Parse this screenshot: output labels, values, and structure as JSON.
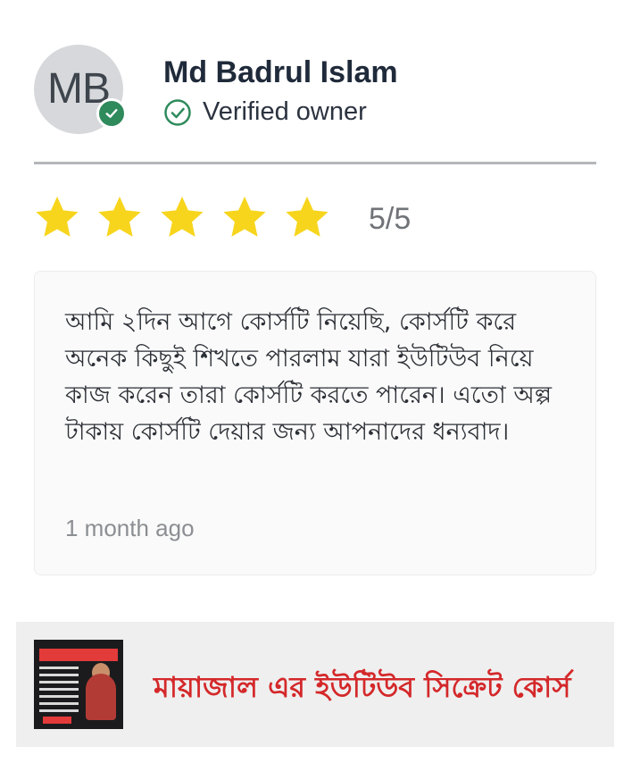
{
  "reviewer": {
    "initials": "MB",
    "name": "Md Badrul Islam",
    "verified_label": "Verified owner"
  },
  "rating": {
    "value": 5,
    "max": 5,
    "label": "5/5",
    "star_color": "#f7d51d"
  },
  "review": {
    "text": "আমি ২দিন আগে কোর্সটি নিয়েছি, কোর্সটি করে অনেক কিছুই শিখতে পারলাম যারা ইউটিউব নিয়ে কাজ করেন তারা কোর্সটি করতে পারেন। এতো অল্প টাকায় কোর্সটি দেয়ার জন্য আপনাদের ধন্যবাদ।",
    "date": "1 month ago"
  },
  "product": {
    "title": "মায়াজাল এর ইউটিউব সিক্রেট কোর্স",
    "title_color": "#d4282a"
  },
  "colors": {
    "verified_green": "#2f8a5c",
    "name_color": "#1f2a3a"
  }
}
